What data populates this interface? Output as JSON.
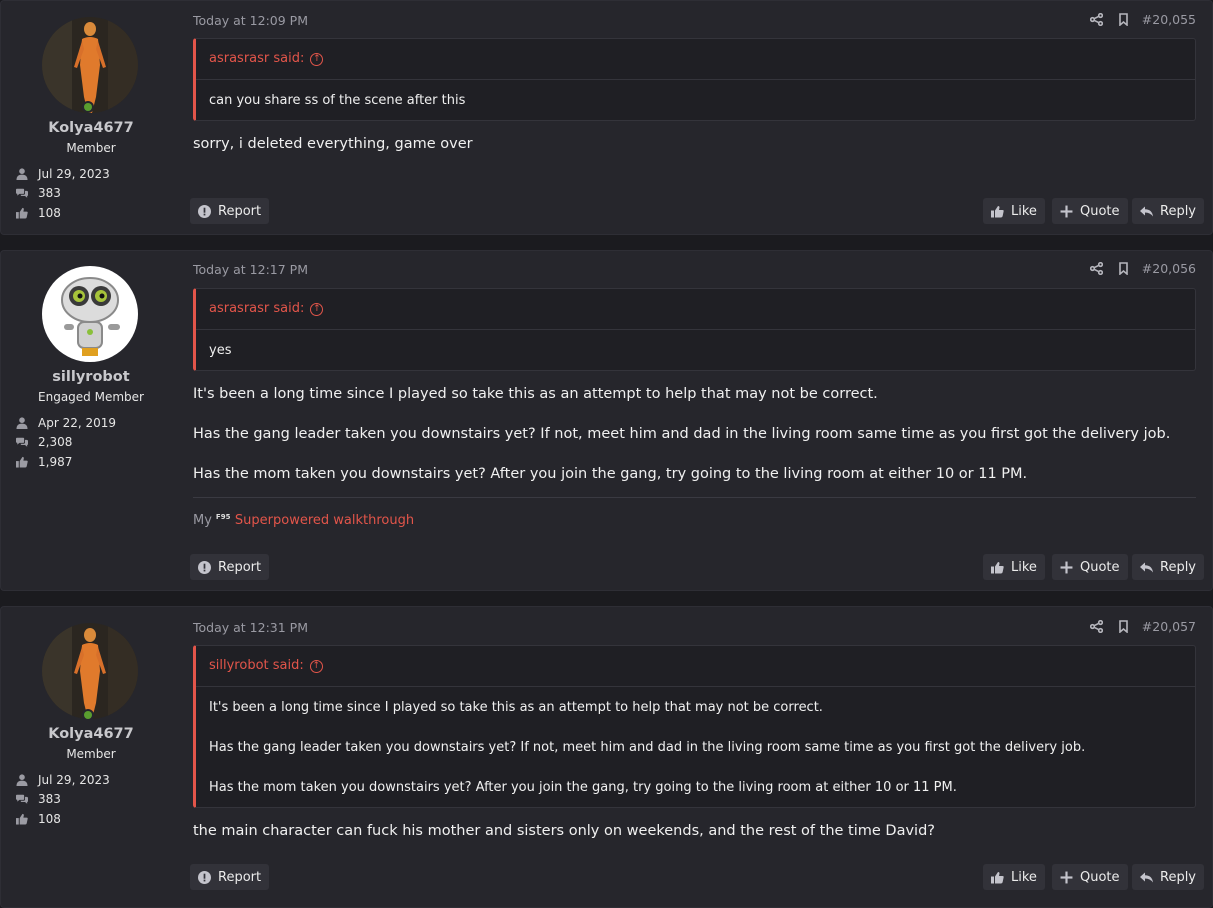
{
  "posts": [
    {
      "author": "Kolya4677",
      "user_title": "Member",
      "joined": "Jul 29, 2023",
      "messages": "383",
      "reactions": "108",
      "date": "Today at 12:09 PM",
      "post_number": "#20,055",
      "quote_author": "asrasrasr said:",
      "quote_lines": [
        "can you share ss of the scene after this"
      ],
      "body_lines": [
        "sorry, i deleted everything, game over"
      ],
      "report": "Report",
      "like": "Like",
      "quote_btn": "Quote",
      "reply": "Reply"
    },
    {
      "author": "sillyrobot",
      "user_title": "Engaged Member",
      "joined": "Apr 22, 2019",
      "messages": "2,308",
      "reactions": "1,987",
      "date": "Today at 12:17 PM",
      "post_number": "#20,056",
      "quote_author": "asrasrasr said:",
      "quote_lines": [
        "yes"
      ],
      "body_lines": [
        "It's been a long time since I played so take this as an attempt to help that may not be correct.",
        "Has the gang leader taken you downstairs yet? If not, meet him and dad in the living room same time as you first got the delivery job.",
        "Has the mom taken you downstairs yet? After you join the gang, try going to the living room at either 10 or 11 PM."
      ],
      "signature_prefix": "My",
      "signature_logo": "F95",
      "signature_link": "Superpowered walkthrough",
      "report": "Report",
      "like": "Like",
      "quote_btn": "Quote",
      "reply": "Reply"
    },
    {
      "author": "Kolya4677",
      "user_title": "Member",
      "joined": "Jul 29, 2023",
      "messages": "383",
      "reactions": "108",
      "date": "Today at 12:31 PM",
      "post_number": "#20,057",
      "quote_author": "sillyrobot said:",
      "quote_lines": [
        "It's been a long time since I played so take this as an attempt to help that may not be correct.",
        "Has the gang leader taken you downstairs yet? If not, meet him and dad in the living room same time as you first got the delivery job.",
        "Has the mom taken you downstairs yet? After you join the gang, try going to the living room at either 10 or 11 PM."
      ],
      "body_lines": [
        "the main character can fuck his mother and sisters only on weekends, and the rest of the time David?"
      ],
      "report": "Report",
      "like": "Like",
      "quote_btn": "Quote",
      "reply": "Reply"
    }
  ],
  "icons": {
    "joined": "user-icon",
    "messages": "comments-icon",
    "reactions": "thumbs-up-icon",
    "share": "share-icon",
    "bookmark": "bookmark-icon",
    "quote_arrow": "arrow-up-circle-icon",
    "report": "exclamation-circle-icon",
    "like": "thumbs-up-icon",
    "quote": "plus-icon",
    "reply": "reply-icon"
  },
  "colors": {
    "accent": "#e2554a",
    "online": "#5a9e2f",
    "post_bg": "#26262c",
    "page_bg": "#1b1b1f"
  }
}
